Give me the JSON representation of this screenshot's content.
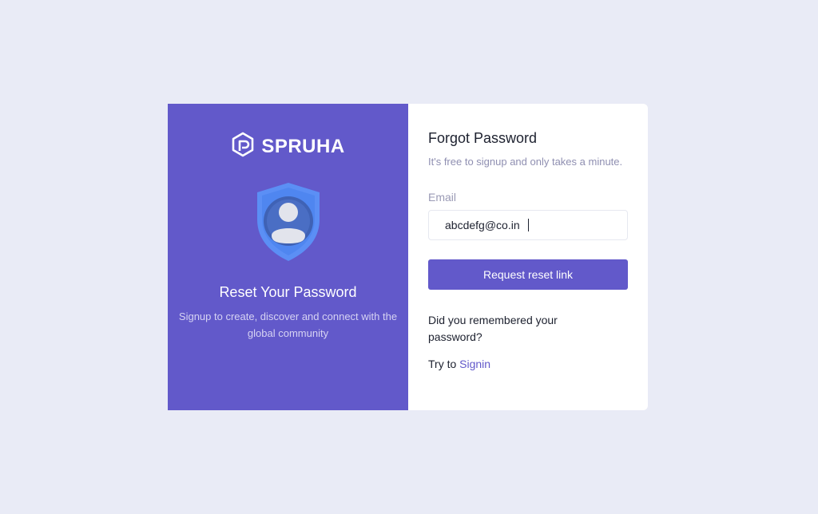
{
  "brand": {
    "name": "SPRUHA",
    "icon": "logo-hexagon-icon"
  },
  "illustration": {
    "icon": "shield-user-icon"
  },
  "left": {
    "title": "Reset Your Password",
    "subtitle": "Signup to create, discover and connect with the global community"
  },
  "form": {
    "title": "Forgot Password",
    "subtitle": "It's free to signup and only takes a minute.",
    "email_label": "Email",
    "email_value": "abcdefg@co.in",
    "submit_label": "Request reset link",
    "question": "Did you remembered your password?",
    "try_text": "Try to",
    "signin_link": "Signin"
  },
  "colors": {
    "background": "#e9ebf6",
    "brand": "#6259ca",
    "panel": "#ffffff"
  }
}
